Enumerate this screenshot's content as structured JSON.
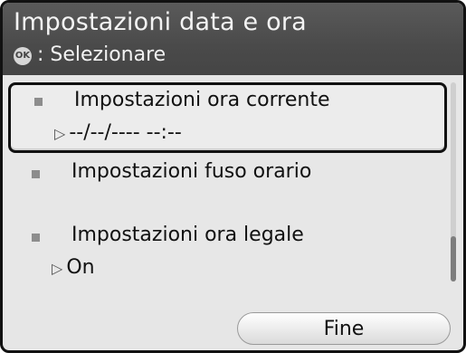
{
  "header": {
    "title": "Impostazioni data e ora",
    "ok_icon_text": "OK",
    "hint_text": ": Selezionare"
  },
  "items": [
    {
      "label": "Impostazioni ora corrente",
      "value": "--/--/---- --:--",
      "selected": true
    },
    {
      "label": "Impostazioni fuso orario",
      "value": "",
      "selected": false
    },
    {
      "label": "Impostazioni ora legale",
      "value": "On",
      "selected": false
    }
  ],
  "value_arrow": "▷",
  "footer": {
    "fine_label": "Fine"
  }
}
